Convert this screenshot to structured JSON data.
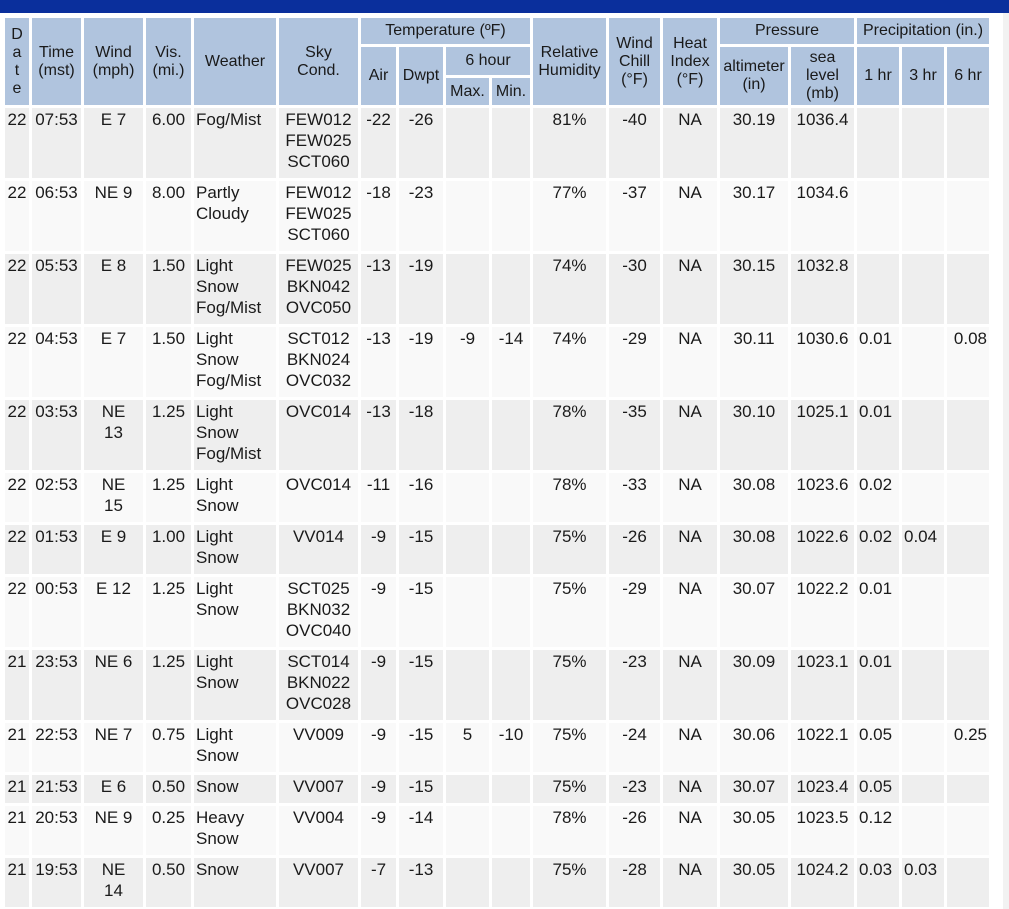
{
  "headers": {
    "date": "D\na\nt\ne",
    "time": "Time\n(mst)",
    "wind": "Wind\n(mph)",
    "vis": "Vis.\n(mi.)",
    "weather": "Weather",
    "sky": "Sky\nCond.",
    "temperature": "Temperature (ºF)",
    "air": "Air",
    "dwpt": "Dwpt",
    "six_hour": "6 hour",
    "max": "Max.",
    "min": "Min.",
    "humidity": "Relative\nHumidity",
    "wind_chill": "Wind\nChill\n(°F)",
    "heat_index": "Heat\nIndex\n(°F)",
    "pressure": "Pressure",
    "altimeter": "altimeter\n(in)",
    "sea_level": "sea\nlevel\n(mb)",
    "precipitation": "Precipitation (in.)",
    "p1": "1 hr",
    "p3": "3 hr",
    "p6": "6 hr"
  },
  "rows": [
    {
      "date": "22",
      "time": "07:53",
      "wind": "E 7",
      "vis": "6.00",
      "weather": "Fog/Mist",
      "sky": "FEW012\nFEW025\nSCT060",
      "air": "-22",
      "dwpt": "-26",
      "max": "",
      "min": "",
      "rh": "81%",
      "chill": "-40",
      "heat": "NA",
      "alt": "30.19",
      "sea": "1036.4",
      "p1": "",
      "p3": "",
      "p6": ""
    },
    {
      "date": "22",
      "time": "06:53",
      "wind": "NE 9",
      "vis": "8.00",
      "weather": "Partly\nCloudy",
      "sky": "FEW012\nFEW025\nSCT060",
      "air": "-18",
      "dwpt": "-23",
      "max": "",
      "min": "",
      "rh": "77%",
      "chill": "-37",
      "heat": "NA",
      "alt": "30.17",
      "sea": "1034.6",
      "p1": "",
      "p3": "",
      "p6": ""
    },
    {
      "date": "22",
      "time": "05:53",
      "wind": "E 8",
      "vis": "1.50",
      "weather": "Light\nSnow\nFog/Mist",
      "sky": "FEW025\nBKN042\nOVC050",
      "air": "-13",
      "dwpt": "-19",
      "max": "",
      "min": "",
      "rh": "74%",
      "chill": "-30",
      "heat": "NA",
      "alt": "30.15",
      "sea": "1032.8",
      "p1": "",
      "p3": "",
      "p6": ""
    },
    {
      "date": "22",
      "time": "04:53",
      "wind": "E 7",
      "vis": "1.50",
      "weather": "Light\nSnow\nFog/Mist",
      "sky": "SCT012\nBKN024\nOVC032",
      "air": "-13",
      "dwpt": "-19",
      "max": "-9",
      "min": "-14",
      "rh": "74%",
      "chill": "-29",
      "heat": "NA",
      "alt": "30.11",
      "sea": "1030.6",
      "p1": "0.01",
      "p3": "",
      "p6": "0.08"
    },
    {
      "date": "22",
      "time": "03:53",
      "wind": "NE\n13",
      "vis": "1.25",
      "weather": "Light\nSnow\nFog/Mist",
      "sky": "OVC014",
      "air": "-13",
      "dwpt": "-18",
      "max": "",
      "min": "",
      "rh": "78%",
      "chill": "-35",
      "heat": "NA",
      "alt": "30.10",
      "sea": "1025.1",
      "p1": "0.01",
      "p3": "",
      "p6": ""
    },
    {
      "date": "22",
      "time": "02:53",
      "wind": "NE\n15",
      "vis": "1.25",
      "weather": "Light\nSnow",
      "sky": "OVC014",
      "air": "-11",
      "dwpt": "-16",
      "max": "",
      "min": "",
      "rh": "78%",
      "chill": "-33",
      "heat": "NA",
      "alt": "30.08",
      "sea": "1023.6",
      "p1": "0.02",
      "p3": "",
      "p6": ""
    },
    {
      "date": "22",
      "time": "01:53",
      "wind": "E 9",
      "vis": "1.00",
      "weather": "Light\nSnow",
      "sky": "VV014",
      "air": "-9",
      "dwpt": "-15",
      "max": "",
      "min": "",
      "rh": "75%",
      "chill": "-26",
      "heat": "NA",
      "alt": "30.08",
      "sea": "1022.6",
      "p1": "0.02",
      "p3": "0.04",
      "p6": ""
    },
    {
      "date": "22",
      "time": "00:53",
      "wind": "E 12",
      "vis": "1.25",
      "weather": "Light\nSnow",
      "sky": "SCT025\nBKN032\nOVC040",
      "air": "-9",
      "dwpt": "-15",
      "max": "",
      "min": "",
      "rh": "75%",
      "chill": "-29",
      "heat": "NA",
      "alt": "30.07",
      "sea": "1022.2",
      "p1": "0.01",
      "p3": "",
      "p6": ""
    },
    {
      "date": "21",
      "time": "23:53",
      "wind": "NE 6",
      "vis": "1.25",
      "weather": "Light\nSnow",
      "sky": "SCT014\nBKN022\nOVC028",
      "air": "-9",
      "dwpt": "-15",
      "max": "",
      "min": "",
      "rh": "75%",
      "chill": "-23",
      "heat": "NA",
      "alt": "30.09",
      "sea": "1023.1",
      "p1": "0.01",
      "p3": "",
      "p6": ""
    },
    {
      "date": "21",
      "time": "22:53",
      "wind": "NE 7",
      "vis": "0.75",
      "weather": "Light\nSnow",
      "sky": "VV009",
      "air": "-9",
      "dwpt": "-15",
      "max": "5",
      "min": "-10",
      "rh": "75%",
      "chill": "-24",
      "heat": "NA",
      "alt": "30.06",
      "sea": "1022.1",
      "p1": "0.05",
      "p3": "",
      "p6": "0.25"
    },
    {
      "date": "21",
      "time": "21:53",
      "wind": "E 6",
      "vis": "0.50",
      "weather": "Snow",
      "sky": "VV007",
      "air": "-9",
      "dwpt": "-15",
      "max": "",
      "min": "",
      "rh": "75%",
      "chill": "-23",
      "heat": "NA",
      "alt": "30.07",
      "sea": "1023.4",
      "p1": "0.05",
      "p3": "",
      "p6": ""
    },
    {
      "date": "21",
      "time": "20:53",
      "wind": "NE 9",
      "vis": "0.25",
      "weather": "Heavy\nSnow",
      "sky": "VV004",
      "air": "-9",
      "dwpt": "-14",
      "max": "",
      "min": "",
      "rh": "78%",
      "chill": "-26",
      "heat": "NA",
      "alt": "30.05",
      "sea": "1023.5",
      "p1": "0.12",
      "p3": "",
      "p6": ""
    },
    {
      "date": "21",
      "time": "19:53",
      "wind": "NE\n14",
      "vis": "0.50",
      "weather": "Snow",
      "sky": "VV007",
      "air": "-7",
      "dwpt": "-13",
      "max": "",
      "min": "",
      "rh": "75%",
      "chill": "-28",
      "heat": "NA",
      "alt": "30.05",
      "sea": "1024.2",
      "p1": "0.03",
      "p3": "0.03",
      "p6": ""
    }
  ]
}
